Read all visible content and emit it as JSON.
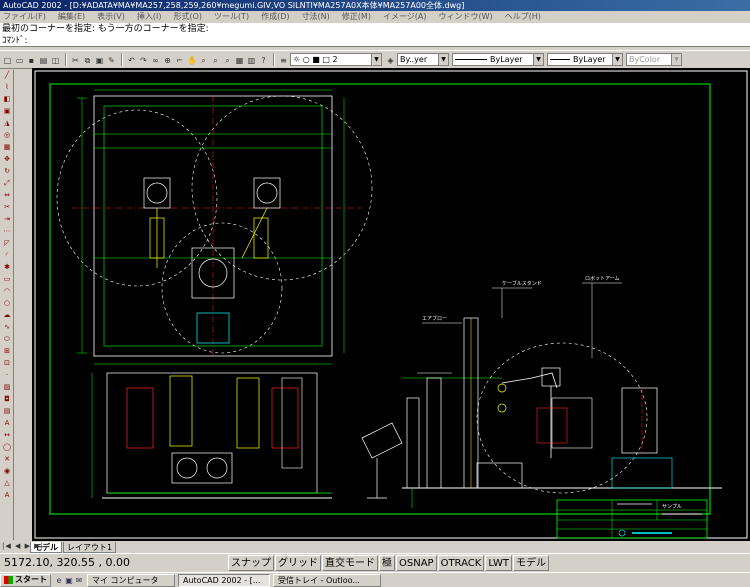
{
  "window": {
    "title": "AutoCAD 2002 - [D:¥ADATA¥MA¥MA257,258,259,260¥megumi.GIV,VO SILNTI¥MA257A0X本体¥MA257A00全体.dwg]"
  },
  "menu": {
    "items": [
      "ファイル(F)",
      "編集(E)",
      "表示(V)",
      "挿入(I)",
      "形式(O)",
      "ツール(T)",
      "作成(D)",
      "寸法(N)",
      "修正(M)",
      "イメージ(A)",
      "ウィンドウ(W)",
      "ヘルプ(H)"
    ]
  },
  "command": {
    "history_line": "最初のコーナーを指定: もう一方のコーナーを指定:",
    "prompt_line": "ｺﾏﾝﾄﾞ:"
  },
  "toolbar": {
    "layer_value": "2",
    "linetype_by": "By..yer",
    "linetype": "ByLayer",
    "lineweight": "ByLayer",
    "plotstyle": "ByColor"
  },
  "tabs": {
    "nav_arrows": "|◀ ◀ ▶ ▶|",
    "items": [
      "モデル",
      "レイアウト1"
    ]
  },
  "status": {
    "coords": "5172.10, 320.55 , 0.00",
    "buttons": [
      "スナップ",
      "グリッド",
      "直交モード",
      "極",
      "OSNAP",
      "OTRACK",
      "LWT",
      "モデル"
    ]
  },
  "taskbar": {
    "start": "スタート",
    "tasks": [
      "マイ コンピュータ",
      "AutoCAD 2002 - [...",
      "受信トレイ - Outloo..."
    ]
  },
  "drawing": {
    "labels": [
      "ケーブルスタンド",
      "ロボットアーム",
      "エアブロー",
      "サンプル"
    ]
  },
  "colors": {
    "canvas_bg": "#000000",
    "green": "#00ff00",
    "white": "#ffffff",
    "red": "#ff2020",
    "yellow": "#ffff00",
    "cyan": "#00ffff",
    "magenta": "#ff00ff"
  }
}
